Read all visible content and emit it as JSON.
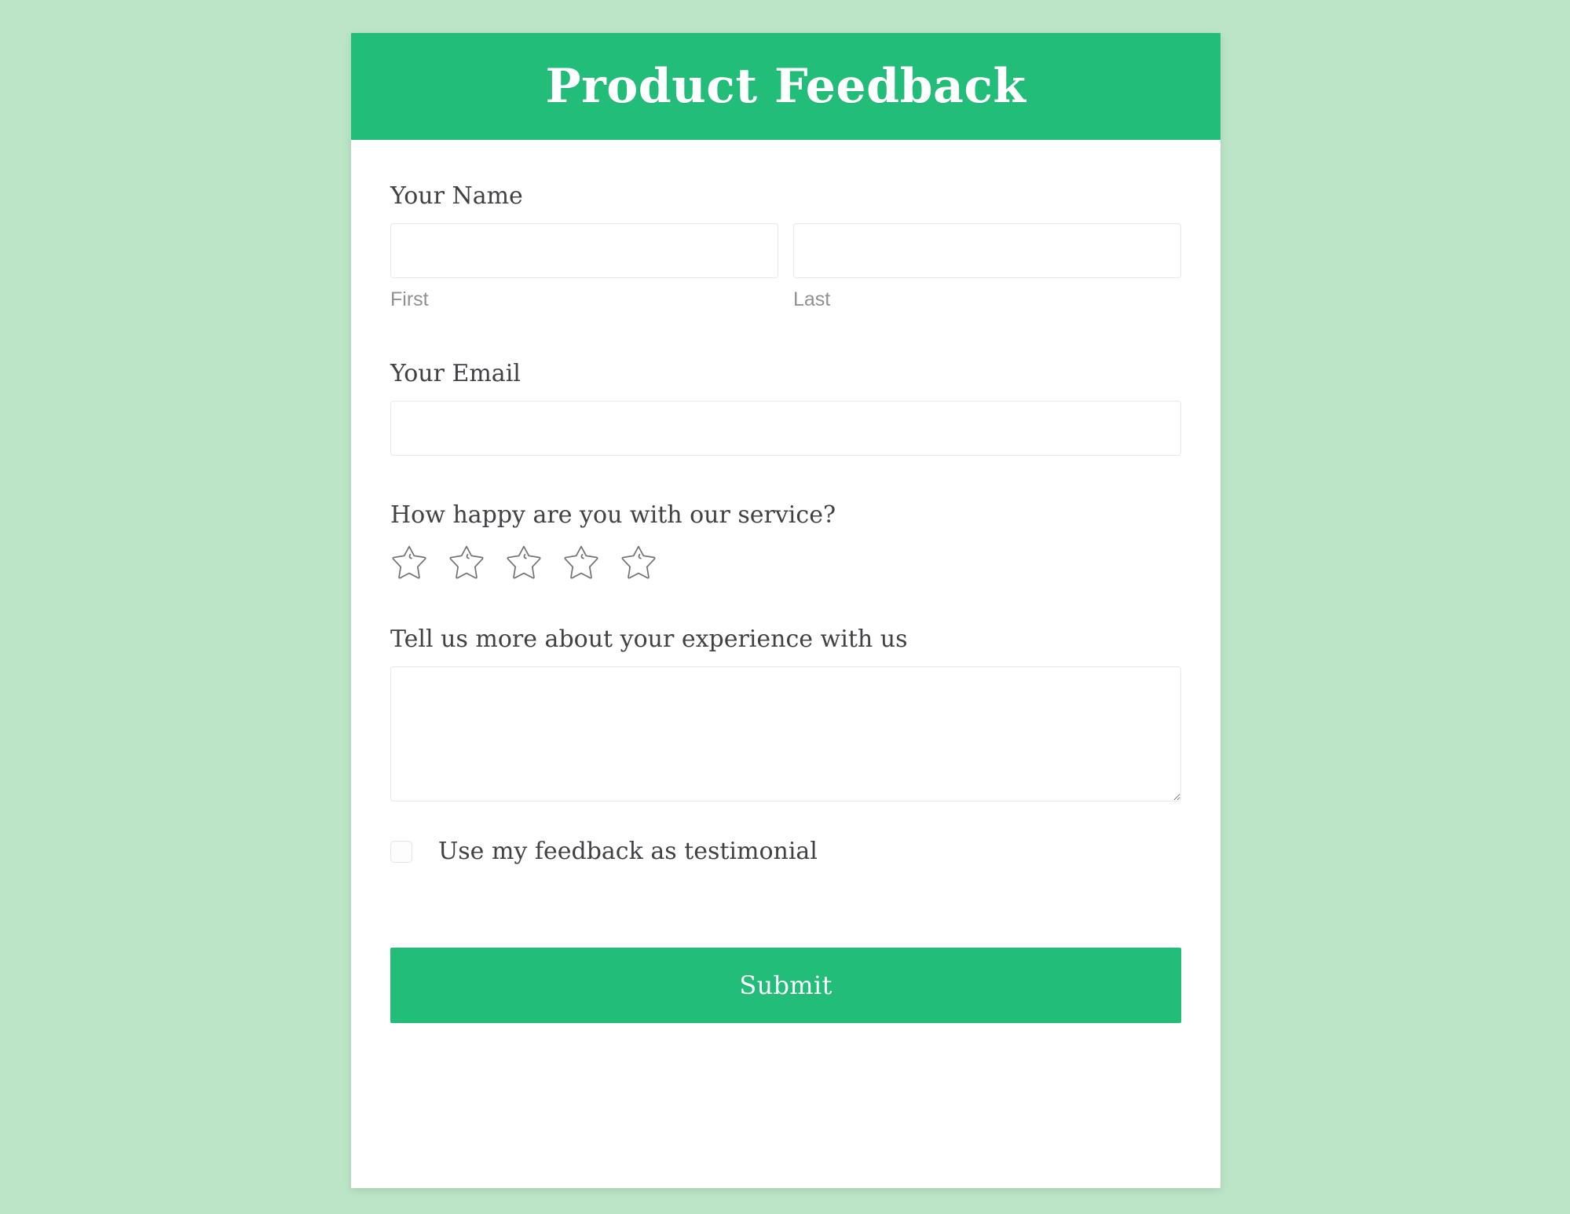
{
  "theme": {
    "page_background": "#bbe5c6",
    "accent_green": "#22bd78",
    "card_background": "#ffffff",
    "label_text": "#3f4144",
    "sub_label_text": "#8e9194",
    "input_border": "#e7e8e9"
  },
  "header": {
    "title": "Product Feedback"
  },
  "form": {
    "name": {
      "label": "Your Name",
      "first": {
        "value": "",
        "placeholder": "",
        "sub_label": "First"
      },
      "last": {
        "value": "",
        "placeholder": "",
        "sub_label": "Last"
      }
    },
    "email": {
      "label": "Your Email",
      "value": "",
      "placeholder": ""
    },
    "rating": {
      "label": "How happy are you with our service?",
      "selected": 0,
      "max": 5,
      "star_icon": "star-outline-icon",
      "stars": [
        {
          "index": 1,
          "filled": false
        },
        {
          "index": 2,
          "filled": false
        },
        {
          "index": 3,
          "filled": false
        },
        {
          "index": 4,
          "filled": false
        },
        {
          "index": 5,
          "filled": false
        }
      ]
    },
    "experience": {
      "label": "Tell us more about your experience with us",
      "value": "",
      "placeholder": "",
      "resize_handle_icon": "resize-grip-icon"
    },
    "testimonial": {
      "label": "Use my feedback as testimonial",
      "checked": false,
      "checkbox_icon": "checkbox-unchecked-icon"
    },
    "submit": {
      "label": "Submit"
    }
  }
}
